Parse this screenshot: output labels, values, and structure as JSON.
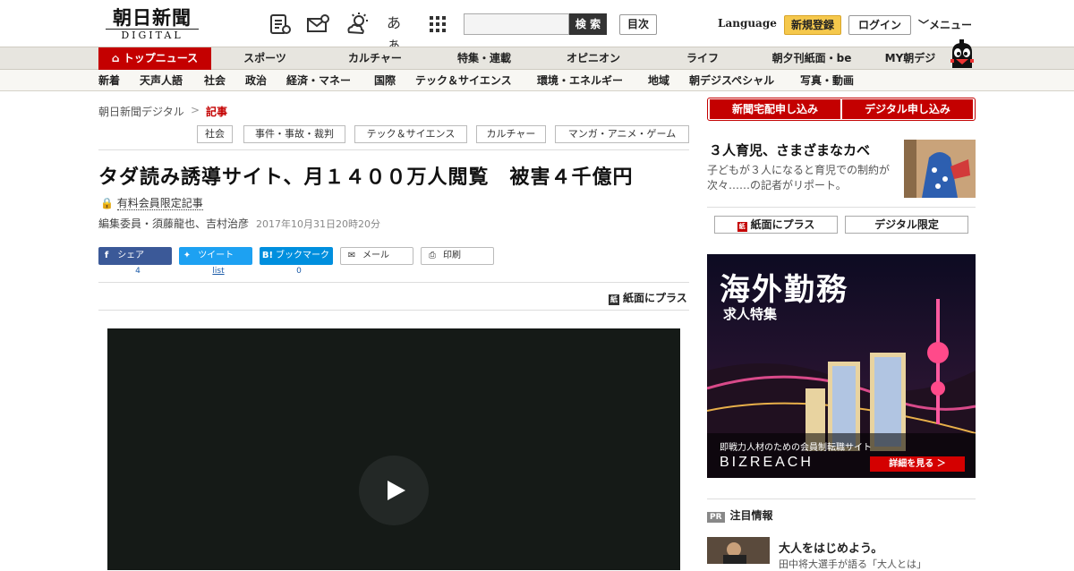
{
  "header": {
    "logo_jp": "朝日新聞",
    "logo_en": "DIGITAL",
    "icons": [
      "news-list-icon",
      "mail-icon",
      "weather-icon",
      "font-size-icon",
      "grid-menu-icon"
    ],
    "font_icon_text": "あぁ",
    "search_button": "検 索",
    "mokuji": "目次",
    "language": "Language",
    "register": "新規登録",
    "login": "ログイン",
    "menu": "メニュー"
  },
  "nav1": [
    "トップニュース",
    "スポーツ",
    "カルチャー",
    "特集・連載",
    "オピニオン",
    "ライフ",
    "朝夕刊紙面・be",
    "MY朝デジ"
  ],
  "nav2": [
    "新着",
    "天声人語",
    "社会",
    "政治",
    "経済・マネー",
    "国際",
    "テック＆サイエンス",
    "環境・エネルギー",
    "地域",
    "朝デジスペシャル",
    "写真・動画"
  ],
  "breadcrumb": {
    "home": "朝日新聞デジタル",
    "sep": ">",
    "current": "記事"
  },
  "tags": [
    "社会",
    "事件・事故・裁判",
    "テック＆サイエンス",
    "カルチャー",
    "マンガ・アニメ・ゲーム"
  ],
  "article": {
    "title": "タダ読み誘導サイト、月１４００万人閲覧　被害４千億円",
    "members_label": "有料会員限定記事",
    "authors": "編集委員・須藤龍也、吉村治彦",
    "date": "2017年10月31日20時20分",
    "print_plus": "紙面にプラス"
  },
  "share": {
    "facebook": {
      "label": "シェア",
      "count": "4"
    },
    "twitter": {
      "label": "ツイート",
      "count": "list"
    },
    "hatena": {
      "label": "ブックマーク",
      "count": "0"
    },
    "mail": "メール",
    "print": "印刷"
  },
  "sidebar": {
    "btn_paper": "新聞宅配申し込み",
    "btn_digital": "デジタル申し込み",
    "feature_title": "３人育児、さまざまなカベ",
    "feature_desc": "子どもが３人になると育児での制約が次々……の記者がリポート。",
    "btn_print_plus": "紙面にプラス",
    "btn_digital_only": "デジタル限定",
    "ad": {
      "title": "海外勤務",
      "subtitle": "求人特集",
      "tagline": "即戦力人材のための会員制転職サイト",
      "brand": "BIZREACH",
      "cta": "詳細を見る ＞"
    },
    "pr_badge": "PR",
    "pr_title": "注目情報",
    "news_title": "大人をはじめよう。",
    "news_sub": "田中将大選手が語る「大人とは」"
  },
  "colors": {
    "accent": "#c40000",
    "facebook": "#3b5998",
    "twitter": "#1da1f2",
    "hatena": "#008fde",
    "register": "#f5c84c"
  }
}
